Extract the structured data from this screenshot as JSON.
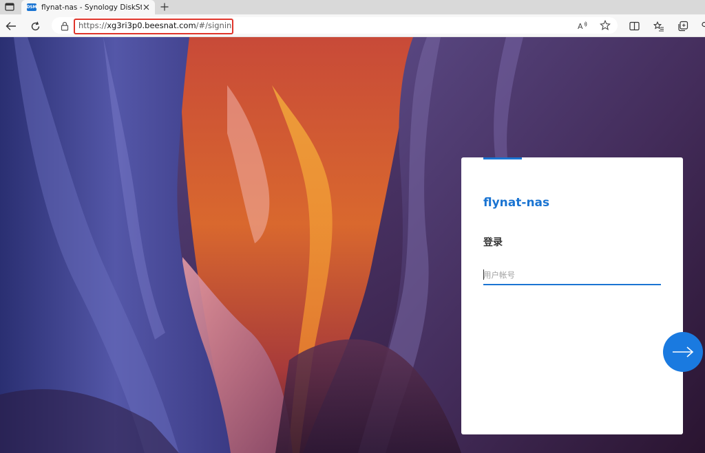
{
  "tab": {
    "favicon_text": "DSM",
    "title": "flynat-nas - Synology DiskStation"
  },
  "address": {
    "url_prefix": "https://",
    "url_host": "xg3ri3p0.beesnat.com",
    "url_path": "/#/signin",
    "highlight_color": "#e0342a"
  },
  "toolbar_icons": [
    "back-icon",
    "refresh-icon",
    "lock-icon",
    "read-aloud-icon",
    "favorite-star-icon",
    "split-screen-icon",
    "favorites-icon",
    "collections-icon"
  ],
  "login": {
    "server_name": "flynat-nas",
    "heading": "登录",
    "username_placeholder": "用户帐号",
    "accent_color": "#1a74d2"
  },
  "next_button": {
    "icon": "arrow-right-icon",
    "color": "#1a7ae0"
  }
}
